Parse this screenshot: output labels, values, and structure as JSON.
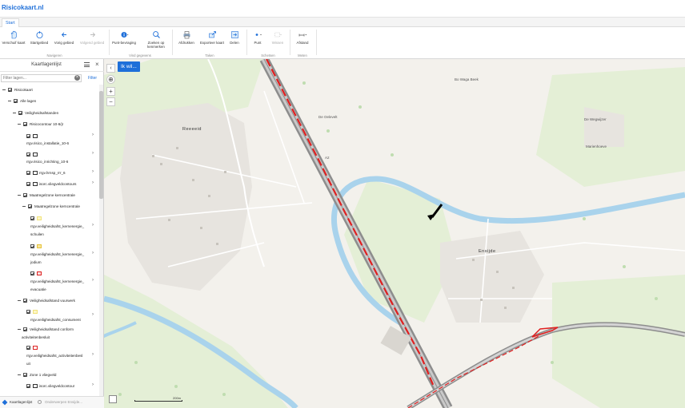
{
  "app": {
    "brand": "Risicokaart.nl"
  },
  "tabs": [
    {
      "label": "Start"
    }
  ],
  "ribbon": {
    "buttons": [
      {
        "label": "Verschuif kaart",
        "icon": "hand-icon",
        "disabled": false
      },
      {
        "label": "Startgebied",
        "icon": "home-icon",
        "disabled": false
      },
      {
        "label": "Vorig gebied",
        "icon": "back-arrow-icon",
        "disabled": false
      },
      {
        "label": "Volgend gebied",
        "icon": "forward-arrow-icon",
        "disabled": true
      },
      {
        "label": "Punt-bevraging",
        "icon": "info-point-icon",
        "disabled": false
      },
      {
        "label": "Zoeken op kenmerken",
        "icon": "search-icon",
        "disabled": false
      },
      {
        "label": "Afdrukken",
        "icon": "print-icon",
        "disabled": false
      },
      {
        "label": "Exporteer kaart",
        "icon": "export-icon",
        "disabled": false
      },
      {
        "label": "Delen",
        "icon": "share-icon",
        "disabled": false
      },
      {
        "label": "Punt",
        "icon": "point-icon",
        "disabled": false
      },
      {
        "label": "Wissen",
        "icon": "erase-icon",
        "disabled": true
      },
      {
        "label": "Afstand",
        "icon": "ruler-icon",
        "disabled": false
      }
    ],
    "groups": [
      "Navigeren",
      "Vind gegevens",
      "Taken",
      "Schetsen",
      "Meten"
    ]
  },
  "panel": {
    "title": "Kaartlagenlijst",
    "filter_placeholder": "Filter lagen...",
    "filter_button": "Filter",
    "footer_tab1": "Kaartlagenlijst",
    "footer_tab2": "Onderwerpen Ensijde..."
  },
  "tree": [
    {
      "label": "Risicokaart"
    },
    {
      "label": "Alle lagen"
    },
    {
      "label": "Veiligheidsafstanden"
    },
    {
      "label": "Risicocontour 10-6/jr"
    },
    {
      "label": "rrgv.risico_installatie_10-6"
    },
    {
      "label": "rrgv.risico_inrichting_10-6"
    },
    {
      "label": "rrgv.hrnsp_rrr_6"
    },
    {
      "label": "isorc.vliegveldcontours"
    },
    {
      "label": "Maatregelzone kerncentrale"
    },
    {
      "label": "Maatregelzone kerncentrale"
    },
    {
      "label": "rrgv.veiligheidsafst_kernenergie_"
    },
    {
      "label": "schuilen"
    },
    {
      "label": "rrgv.veiligheidsafst_kernenergie_"
    },
    {
      "label": "jodium"
    },
    {
      "label": "rrgv.veiligheidsafst_kernenergie_"
    },
    {
      "label": "evacuatie"
    },
    {
      "label": "Veiligheidsafstand vuurwerk"
    },
    {
      "label": "rrgv.veiligheidsafst_consument"
    },
    {
      "label": "Veiligheidsafstand conform"
    },
    {
      "label": "activiteitenbesluit"
    },
    {
      "label": "rrgv.veiligheidsafst_activiteitenbesl"
    },
    {
      "label": "uit"
    },
    {
      "label": "Zone 1 vliegveld"
    },
    {
      "label": "isorc.vliegveldcontour"
    }
  ],
  "map": {
    "button_label": "Ik wil...",
    "scale_label": "200m",
    "labels": {
      "town1": "Reeeeid",
      "town2": "Ensijde",
      "farm1": "De Oelevelt",
      "farm2": "De Wegwijzer",
      "farm3": "Marienhoeve",
      "farm4": "Bo Waga Beek",
      "road": "A2"
    }
  },
  "colors": {
    "accent": "#1e6fd9",
    "contour": "#e02020",
    "water": "#a9d3ec",
    "road": "#9a9a9a",
    "green": "#dceccf"
  }
}
